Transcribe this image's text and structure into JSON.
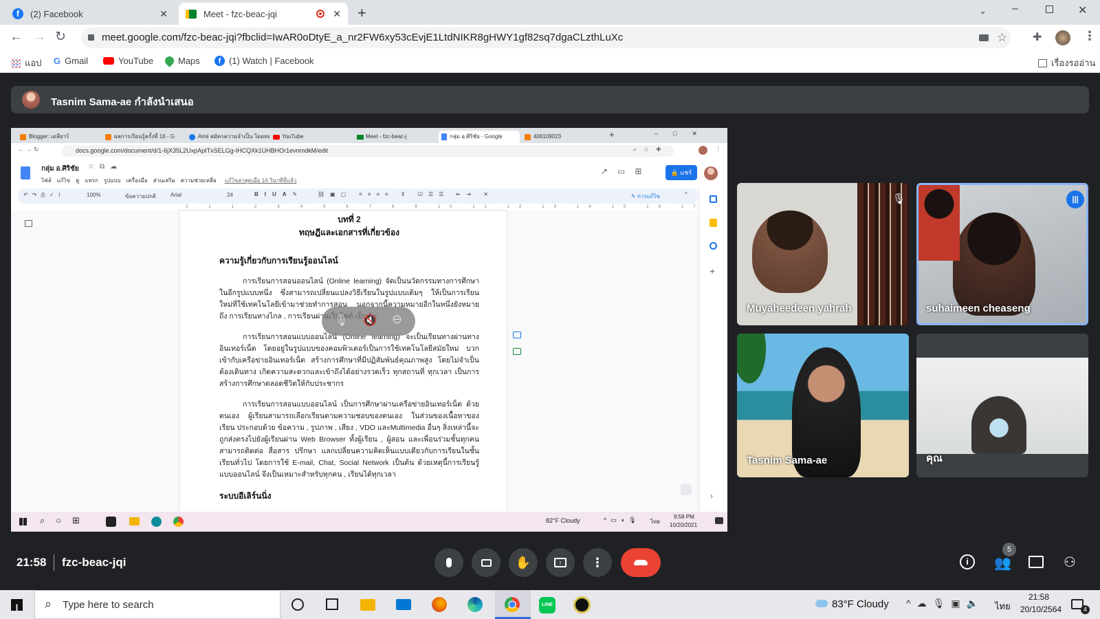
{
  "browser": {
    "tabs": [
      {
        "title": "(2) Facebook",
        "active": false
      },
      {
        "title": "Meet - fzc-beac-jqi",
        "active": true
      }
    ],
    "url": "meet.google.com/fzc-beac-jqi?fbclid=IwAR0oDtyE_a_nr2FW6xy53cEvjE1LtdNIKR8gHWY1gf82sq7dgaCLzthLuXc",
    "bookmarks": [
      "แอป",
      "Gmail",
      "YouTube",
      "Maps",
      "(1) Watch | Facebook"
    ],
    "reading_list": "เรื่องรออ่าน"
  },
  "meet": {
    "presenter_text": "Tasnim Sama-ae กำลังนำเสนอ",
    "time": "21:58",
    "meeting_code": "fzc-beac-jqi",
    "participant_count": "5",
    "participants": [
      {
        "name": "Muyaheedeen yahrah",
        "muted": true
      },
      {
        "name": "suhaimeen cheaseng",
        "speaking": true
      },
      {
        "name": "Tasnim Sama-ae"
      },
      {
        "name": "คุณ"
      }
    ]
  },
  "shared_screen": {
    "tabs": [
      "Blogger: เดลียาร์",
      "ผลการเรียนรู้ครั้งที่ 16 - G",
      "Amii สมัครความจำเป็น โดยหม",
      "YouTube",
      "Meet - fzc-beac-j",
      "กลุ่ม อ.ศิริชัย - Google",
      "406109023"
    ],
    "url": "docs.google.com/document/d/1-6jX35L2UxpAptTxSELGg-IHCQXk1UHBHOr1evnmdkM/edit",
    "doc_title": "กลุ่ม อ.ศิริชัย",
    "menu": [
      "ไฟล์",
      "แก้ไข",
      "ดู",
      "แทรก",
      "รูปแบบ",
      "เครื่องมือ",
      "ส่วนเสริม",
      "ความช่วยเหลือ"
    ],
    "last_edit": "แก้ไขล่าสุดเมื่อ 14 วินาทีที่แล้ว",
    "share_label": "แชร์",
    "zoom": "100%",
    "style": "ข้อความปกติ",
    "font": "Arial",
    "font_size": "24",
    "editing_mode": "การแก้ไข",
    "chapter": "บทที่ 2",
    "chapter_title": "ทฤษฎีและเอกสารที่เกี่ยวข้อง",
    "heading1": "ความรู้เกี่ยวกับการเรียนรู้ออนไลน์",
    "paragraphs": [
      "การเรียนการสอนออนไลน์ (Online learning) จัดเป็นนวัตกรรมทางการศึกษาในอีกรูปแบบหนึ่ง ซึ่งสามารถเปลี่ยนแปลงวิธีเรียนในรูปแบบเดิมๆ ให้เป็นการเรียนใหม่ที่ใช้เทคโนโลยีเข้ามาช่วยทำการสอน นอกจากนี้ความหมายอีกในหนึ่งยังหมายถึง การเรียนทางไกล , การเรียนผ่านเว็บไซต์ เป็นต้น",
      "การเรียนการสอนแบบออนไลน์ (Online learning) จะเป็นเรียนทางผ่านทางอินเทอร์เน็ต โดยอยู่ในรูปแบบของคอมพิวเตอร์เป็นการใช้เทคโนโลยีสมัยใหม่ บวกเข้ากับเครือข่ายอินเทอร์เน็ต สร้างการศึกษาที่มีปฏิสัมพันธ์คุณภาพสูง โดยไม่จำเป็นต้องเดินทาง เกิดความสะดวกและเข้าถึงได้อย่างรวดเร็ว ทุกสถานที่ ทุกเวลา เป็นการสร้างการศึกษาตลอดชีวิตให้กับประชากร",
      "การเรียนการสอนแบบออนไลน์ เป็นการศึกษาผ่านเครือข่ายอินเทอร์เน็ต ด้วยตนเอง ผู้เรียนสามารถเลือกเรียนตามความชอบของตนเอง ในส่วนของเนื้อหาของเรียน ประกอบด้วย ข้อความ , รูปภาพ , เสียง , VDO และMultimedia อื่นๆ สิ่งเหล่านี้จะถูกส่งตรงไปยังผู้เรียนผ่าน Web Browser ทั้งผู้เรียน , ผู้สอน และเพื่อนร่วมชั้นทุกคนสามารถติดต่อ สื่อสาร ปรึกษา แลกเปลี่ยนความคิดเห็นแบบเดียวกับการเรียนในชั้นเรียนทั่วไป โดยการใช้ E-mail, Chat, Social Network เป็นต้น ด้วยเหตุนี้การเรียนรู้แบบออนไลน์ จึงเป็นเหมาะสำหรับทุกคน , เรียนได้ทุกเวลา"
    ],
    "heading2": "ระบบอีเลิร์นนิ่ง",
    "weather": "82°F  Cloudy",
    "lang": "ไทย",
    "clock_time": "9:58 PM",
    "clock_date": "10/20/2021"
  },
  "taskbar": {
    "search_placeholder": "Type here to search",
    "weather": "83°F  Cloudy",
    "lang": "ไทย",
    "time": "21:58",
    "date": "20/10/2564",
    "notifications": "4"
  },
  "colors": {
    "meet_bg": "#202124",
    "end_call": "#ea4335",
    "speaking_border": "#8ab4f8",
    "docs_blue": "#1a73e8"
  }
}
